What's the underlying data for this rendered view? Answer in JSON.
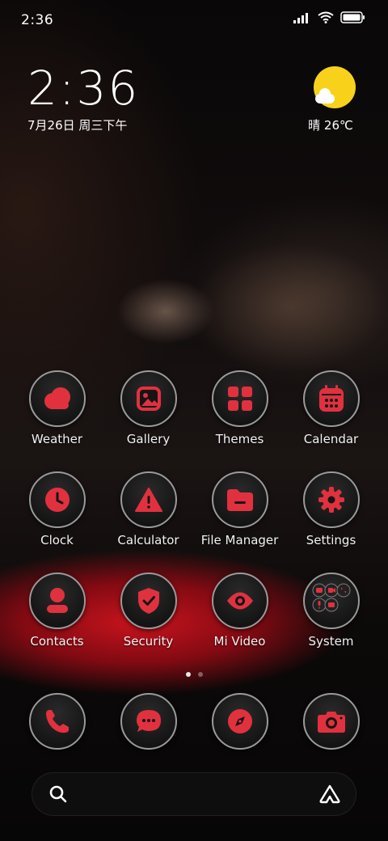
{
  "status_bar": {
    "time": "2:36",
    "icons": [
      "signal-icon",
      "wifi-icon",
      "battery-icon"
    ]
  },
  "clock_widget": {
    "time": "2:36",
    "date": "7月26日 周三下午"
  },
  "weather_widget": {
    "text": "晴 26℃",
    "icon": "sun-cloud-icon"
  },
  "theme": {
    "accent": "#e1313f",
    "icon_bg": "#151515",
    "icon_border": "#9a9a9a",
    "sun": "#f8d21a"
  },
  "apps": [
    {
      "label": "Weather",
      "icon": "cloud-icon"
    },
    {
      "label": "Gallery",
      "icon": "image-icon"
    },
    {
      "label": "Themes",
      "icon": "grid-icon"
    },
    {
      "label": "Calendar",
      "icon": "calendar-icon"
    },
    {
      "label": "Clock",
      "icon": "clock-icon"
    },
    {
      "label": "Calculator",
      "icon": "warning-icon"
    },
    {
      "label": "File Manager",
      "icon": "folder-icon"
    },
    {
      "label": "Settings",
      "icon": "gear-icon"
    },
    {
      "label": "Contacts",
      "icon": "person-icon"
    },
    {
      "label": "Security",
      "icon": "shield-icon"
    },
    {
      "label": "Mi Video",
      "icon": "eye-icon"
    },
    {
      "label": "System",
      "icon": "folder-grid-icon"
    }
  ],
  "pager": {
    "pages": 2,
    "active": 1
  },
  "dock": [
    {
      "icon": "phone-icon"
    },
    {
      "icon": "message-icon"
    },
    {
      "icon": "compass-icon"
    },
    {
      "icon": "camera-icon"
    }
  ],
  "search_bar": {
    "left_icon": "search-icon",
    "right_icon": "assistant-icon"
  }
}
